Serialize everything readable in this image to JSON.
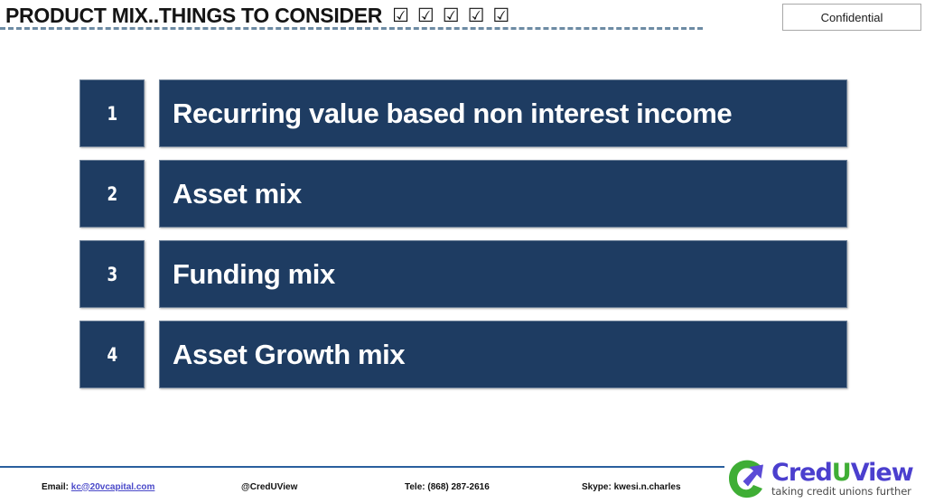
{
  "slide": {
    "title": "PRODUCT MIX..THINGS TO CONSIDER",
    "title_checkmarks": [
      "☑",
      "☑",
      "☑",
      "☑",
      "☑"
    ],
    "confidential_label": "Confidential",
    "accent_color": "#1e3c62",
    "underline_color": "#6d8ba4",
    "footer_rule_color": "#2a5f9e"
  },
  "items": [
    {
      "number": "1",
      "label": "Recurring value based non interest income"
    },
    {
      "number": "2",
      "label": "Asset mix"
    },
    {
      "number": "3",
      "label": "Funding mix"
    },
    {
      "number": "4",
      "label": "Asset Growth mix"
    }
  ],
  "footer": {
    "email_prefix": "Email:",
    "email_address": "kc@20vcapital.com",
    "twitter_handle": "@CredUView",
    "telephone": "Tele: (868) 287-2616",
    "skype": "Skype: kwesi.n.charles"
  },
  "logo": {
    "word_cred": "Cred",
    "word_u": "U",
    "word_view": "View",
    "tagline": "taking credit unions further",
    "mark_green": "#3fae35",
    "mark_purple": "#5b4bd6",
    "text_purple": "#4b3fce",
    "text_green": "#3fae35"
  }
}
